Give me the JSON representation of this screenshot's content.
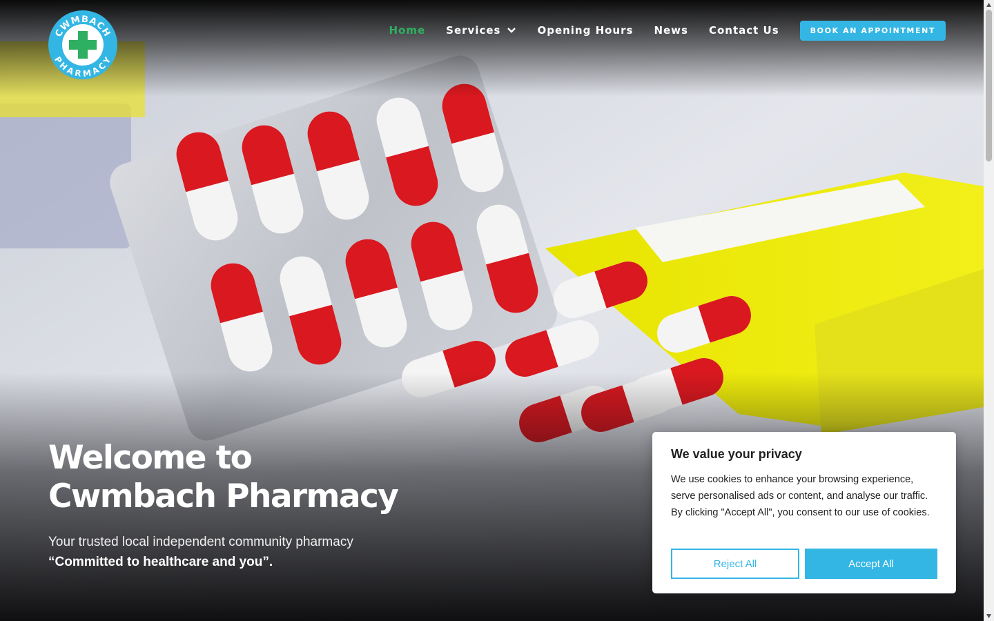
{
  "brand": {
    "logo_text_top": "CWMBACH",
    "logo_text_bottom": "PHARMACY",
    "accent": "#33b6e4",
    "green": "#2faf62"
  },
  "nav": {
    "items": [
      {
        "label": "Home",
        "active": true
      },
      {
        "label": "Services",
        "has_dropdown": true
      },
      {
        "label": "Opening Hours"
      },
      {
        "label": "News"
      },
      {
        "label": "Contact Us"
      }
    ],
    "cta": "BOOK AN APPOINTMENT"
  },
  "hero": {
    "title": "Welcome to Cwmbach Pharmacy",
    "subtitle": "Your trusted local independent community pharmacy",
    "quote": "“Committed to healthcare and you”."
  },
  "cookie": {
    "title": "We value your privacy",
    "text": "We use cookies to enhance your browsing experience, serve personalised ads or content, and analyse our traffic. By clicking \"Accept All\", you consent to our use of cookies.",
    "reject": "Reject All",
    "accept": "Accept All"
  },
  "icons": {
    "logo": "pharmacy-cross-logo",
    "dropdown": "chevron-down-icon"
  }
}
